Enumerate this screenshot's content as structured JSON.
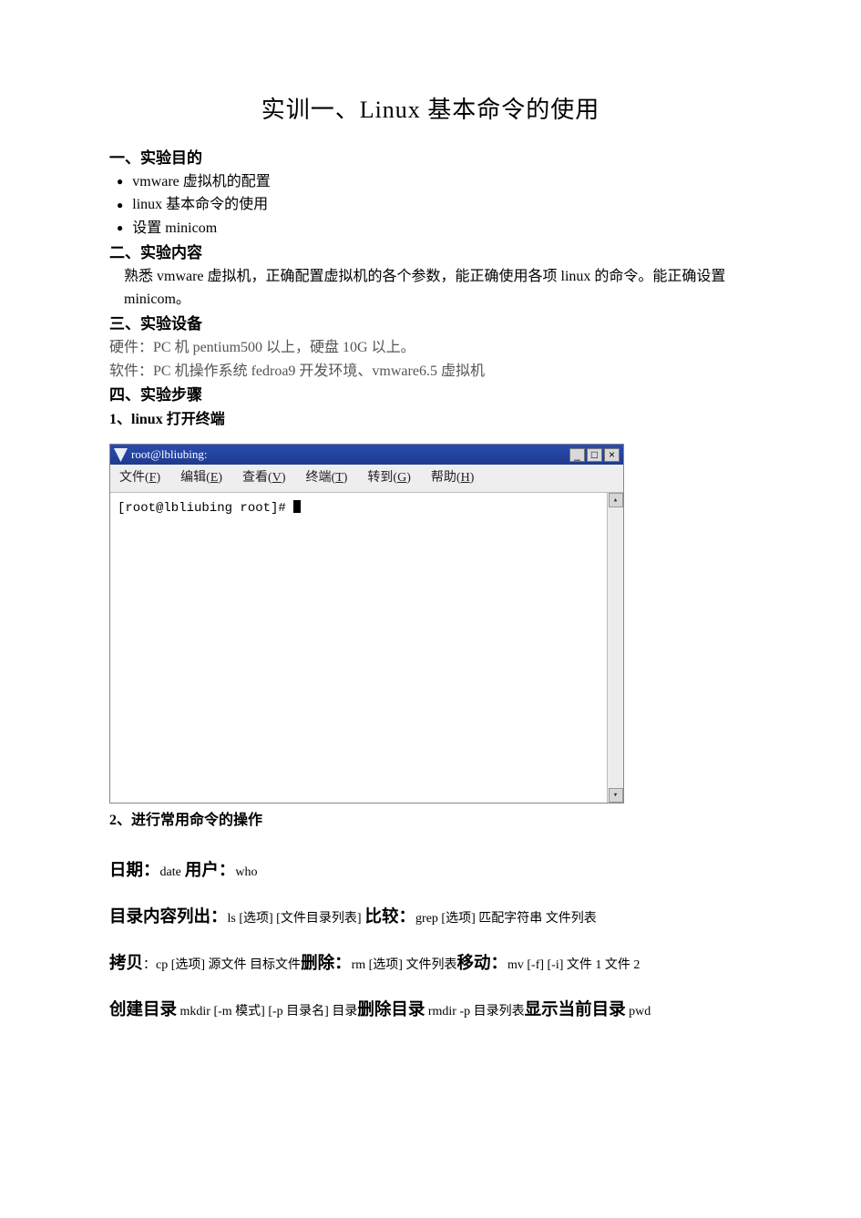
{
  "title": "实训一、Linux 基本命令的使用",
  "s1": {
    "heading": "一、实验目的",
    "bullets": [
      "vmware 虚拟机的配置",
      "linux 基本命令的使用",
      "设置 minicom"
    ]
  },
  "s2": {
    "heading": "二、实验内容",
    "text": "熟悉 vmware 虚拟机，正确配置虚拟机的各个参数，能正确使用各项 linux 的命令。能正确设置 minicom。"
  },
  "s3": {
    "heading": "三、实验设备",
    "hw": "硬件：PC 机 pentium500 以上，硬盘 10G 以上。",
    "sw": "软件：PC 机操作系统 fedroa9 开发环境、vmware6.5 虚拟机"
  },
  "s4": {
    "heading": "四、实验步骤",
    "step1": "1、linux 打开终端",
    "step2": "2、进行常用命令的操作"
  },
  "term": {
    "title": "root@lbliubing:",
    "menus": {
      "file": "文件(",
      "file_u": "F",
      "file_e": ")",
      "edit": "编辑(",
      "edit_u": "E",
      "edit_e": ")",
      "view": "查看(",
      "view_u": "V",
      "view_e": ")",
      "terminal": "终端(",
      "terminal_u": "T",
      "terminal_e": ")",
      "go": "转到(",
      "go_u": "G",
      "go_e": ")",
      "help": "帮助(",
      "help_u": "H",
      "help_e": ")"
    },
    "prompt": "[root@lbliubing root]# ",
    "scroll_up": "▴",
    "scroll_down": "▾",
    "min": "_",
    "max": "□",
    "close": "×"
  },
  "cmds": {
    "date_lbl": "日期：",
    "date_cmd": "date",
    "user_lbl": "用户：",
    "user_cmd": "who",
    "ls_lbl": "目录内容列出：",
    "ls_cmd": "ls [选项] [文件目录列表]",
    "cmp_lbl": "比较：",
    "cmp_cmd": "grep [选项]  匹配字符串  文件列表",
    "cp_lbl": "拷贝",
    "cp_sep": "：",
    "cp_cmd": "cp   [选项]     源文件    目标文件",
    "rm_lbl": "删除：",
    "rm_cmd": "rm  [选项]  文件列表",
    "mv_lbl": "移动：",
    "mv_cmd": "mv  [-f]  [-i]   文件 1  文件 2",
    "mkdir_lbl": "创建目录",
    "mkdir_cmd": " mkdir [-m 模式] [-p 目录名]  目录",
    "rmdir_lbl": "删除目录",
    "rmdir_cmd": " rmdir  -p    目录列表",
    "pwd_lbl": "显示当前目录",
    "pwd_cmd": " pwd"
  }
}
